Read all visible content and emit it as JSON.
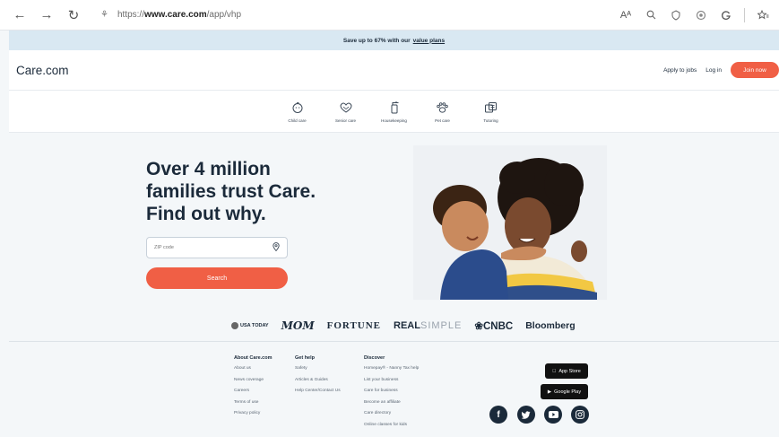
{
  "browser": {
    "url_prefix": "https://",
    "url_domain": "www.care.com",
    "url_path": "/app/vhp",
    "read_aloud": "Aᴬ"
  },
  "promo": {
    "text": "Save up to 67% with our",
    "link": "value plans"
  },
  "header": {
    "logo": "Care.com",
    "apply": "Apply to jobs",
    "login": "Log in",
    "join": "Join now"
  },
  "categories": [
    {
      "label": "Child care",
      "icon": "child-care-icon"
    },
    {
      "label": "Senior care",
      "icon": "senior-care-icon"
    },
    {
      "label": "Housekeeping",
      "icon": "housekeeping-icon"
    },
    {
      "label": "Pet care",
      "icon": "pet-care-icon"
    },
    {
      "label": "Tutoring",
      "icon": "tutoring-icon"
    }
  ],
  "hero": {
    "line1": "Over 4 million",
    "line2": "families trust Care.",
    "line3": "Find out why.",
    "zip_placeholder": "ZIP code",
    "search": "Search"
  },
  "press": {
    "usa": "USA TODAY",
    "mom": "MOM",
    "fortune": "FORTUNE",
    "real": "REAL",
    "simple": "SIMPLE",
    "cnbc": "CNBC",
    "bloomberg": "Bloomberg"
  },
  "footer": {
    "about": {
      "title": "About Care.com",
      "items": [
        "About us",
        "News coverage",
        "Careers",
        "Terms of use",
        "Privacy policy"
      ]
    },
    "help": {
      "title": "Get help",
      "items": [
        "Safety",
        "Articles & Guides",
        "Help Center/Contact Us"
      ]
    },
    "discover": {
      "title": "Discover",
      "items": [
        "Homepay® - Nanny Tax help",
        "List your business",
        "Care for business",
        "Become an affiliate",
        "Care directory",
        "Online classes for kids"
      ]
    },
    "appstore": "App Store",
    "googleplay": "Google Play"
  },
  "colors": {
    "accent": "#f05f45",
    "navy": "#1b2a3a",
    "promo_bg": "#d9e8f2"
  }
}
